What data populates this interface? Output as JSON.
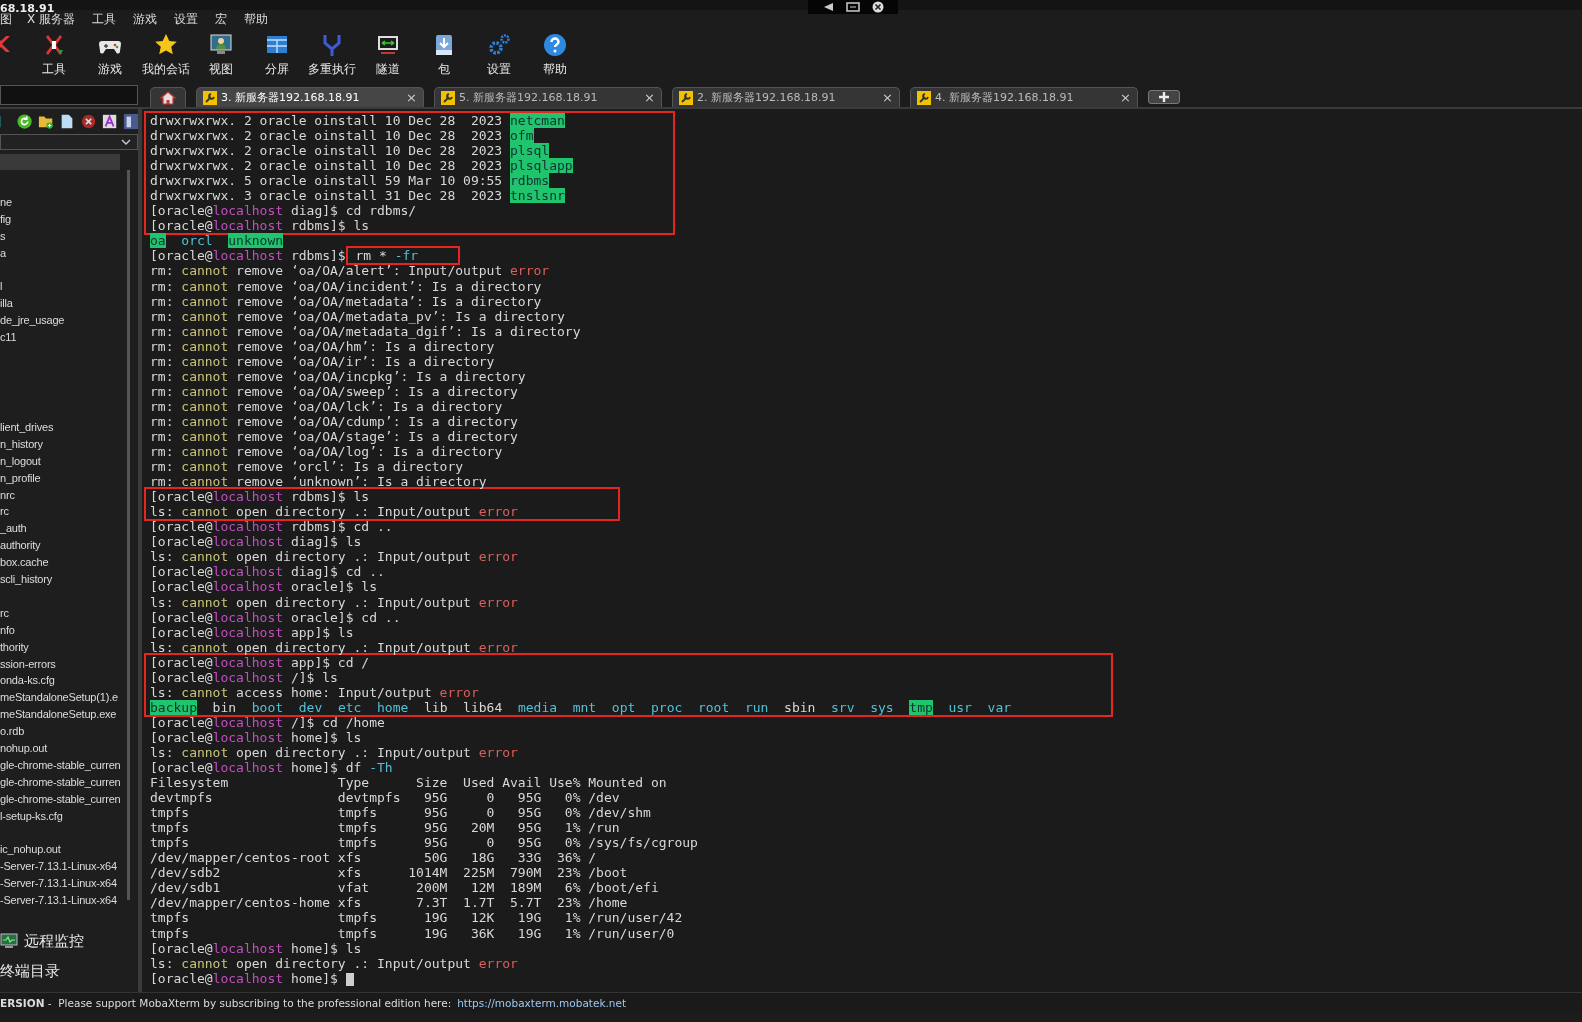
{
  "window": {
    "title": "68.18.91"
  },
  "menu": [
    "图",
    "X 服务器",
    "工具",
    "游戏",
    "设置",
    "宏",
    "帮助"
  ],
  "toolbar": [
    {
      "kind": "server"
    },
    {
      "kind": "tools",
      "label": "工具"
    },
    {
      "kind": "games",
      "label": "游戏"
    },
    {
      "kind": "sessions",
      "label": "我的会话"
    },
    {
      "kind": "view",
      "label": "视图"
    },
    {
      "kind": "split",
      "label": "分屏"
    },
    {
      "kind": "multiexec",
      "label": "多重执行"
    },
    {
      "kind": "tunnel",
      "label": "隧道"
    },
    {
      "kind": "packages",
      "label": "包"
    },
    {
      "kind": "settings",
      "label": "设置"
    },
    {
      "kind": "help",
      "label": "帮助"
    }
  ],
  "tabs": [
    {
      "kind": "home",
      "selected": false
    },
    {
      "kind": "session",
      "label": "3. 新服务器192.168.18.91",
      "close": "×",
      "selected": true
    },
    {
      "kind": "session",
      "label": "5. 新服务器192.168.18.91",
      "close": "×",
      "selected": false
    },
    {
      "kind": "session",
      "label": "2. 新服务器192.168.18.91",
      "close": "×",
      "selected": false
    },
    {
      "kind": "session",
      "label": "4. 新服务器192.168.18.91",
      "close": "×",
      "selected": false
    }
  ],
  "sidebar": {
    "tools": [
      {
        "kind": "terminal"
      },
      {
        "kind": "refresh"
      },
      {
        "kind": "new-folder"
      },
      {
        "kind": "new-file"
      },
      {
        "kind": "delete"
      },
      {
        "kind": "text"
      },
      {
        "kind": "panel"
      }
    ],
    "groups": [
      [
        "ne",
        "fig",
        "s",
        "a"
      ],
      [
        "l",
        "illa",
        "de_jre_usage",
        "c11"
      ],
      [
        "lient_drives",
        "n_history",
        "n_logout",
        "n_profile",
        "nrc",
        "rc",
        "_auth",
        "authority",
        "box.cache",
        "scli_history"
      ],
      [
        "rc",
        "nfo",
        "thority",
        "ssion-errors",
        "onda-ks.cfg",
        "meStandaloneSetup(1).e",
        "meStandaloneSetup.exe",
        "o.rdb",
        "nohup.out",
        "gle-chrome-stable_curren",
        "gle-chrome-stable_curren",
        "gle-chrome-stable_curren",
        "l-setup-ks.cfg"
      ],
      [
        "ic_nohup.out",
        "-Server-7.13.1-Linux-x64",
        "-Server-7.13.1-Linux-x64",
        "-Server-7.13.1-Linux-x64"
      ]
    ],
    "bottom": [
      {
        "kind": "monitor",
        "label": "远程监控"
      },
      {
        "kind": "plain",
        "label": "终端目录"
      }
    ]
  },
  "terminal": {
    "blocks": [
      {
        "boxed": true,
        "lines": [
          {
            "segments": [
              {
                "kind": "text",
                "text": "drwxrwxrwx. 2 oracle oinstall 10 Dec 28  2023 "
              },
              {
                "kind": "dirhl",
                "text": "netcman"
              }
            ]
          },
          {
            "segments": [
              {
                "kind": "text",
                "text": "drwxrwxrwx. 2 oracle oinstall 10 Dec 28  2023 "
              },
              {
                "kind": "dirhl",
                "text": "ofm"
              }
            ]
          },
          {
            "segments": [
              {
                "kind": "text",
                "text": "drwxrwxrwx. 2 oracle oinstall 10 Dec 28  2023 "
              },
              {
                "kind": "dirhl",
                "text": "plsql"
              }
            ]
          },
          {
            "segments": [
              {
                "kind": "text",
                "text": "drwxrwxrwx. 2 oracle oinstall 10 Dec 28  2023 "
              },
              {
                "kind": "dirhl",
                "text": "plsqlapp"
              }
            ]
          },
          {
            "segments": [
              {
                "kind": "text",
                "text": "drwxrwxrwx. 5 oracle oinstall 59 Mar 10 09:55 "
              },
              {
                "kind": "dirhl",
                "text": "rdbms"
              }
            ]
          },
          {
            "segments": [
              {
                "kind": "text",
                "text": "drwxrwxrwx. 3 oracle oinstall 31 Dec 28  2023 "
              },
              {
                "kind": "dirhl",
                "text": "tnslsnr"
              }
            ]
          },
          {
            "segments": [
              {
                "kind": "text",
                "text": "[oracle@"
              },
              {
                "kind": "host",
                "text": "localhost"
              },
              {
                "kind": "text",
                "text": " diag]$ cd rdbms/"
              }
            ]
          },
          {
            "segments": [
              {
                "kind": "text",
                "text": "[oracle@"
              },
              {
                "kind": "host",
                "text": "localhost"
              },
              {
                "kind": "text",
                "text": " rdbms]$ ls"
              }
            ]
          }
        ]
      },
      {
        "boxed": false,
        "lines": [
          {
            "segments": [
              {
                "kind": "dirhl",
                "text": "oa"
              },
              {
                "kind": "dir",
                "text": "  orcl  "
              },
              {
                "kind": "dirhl",
                "text": "unknown"
              }
            ]
          },
          {
            "segments": [
              {
                "kind": "text",
                "text": "[oracle@"
              },
              {
                "kind": "host",
                "text": "localhost"
              },
              {
                "kind": "text",
                "text": " rdbms]$"
              },
              {
                "kind": "group",
                "boxed": true,
                "segments": [
                  {
                    "kind": "text",
                    "text": " rm * "
                  },
                  {
                    "kind": "opt",
                    "text": "-fr"
                  }
                ]
              }
            ]
          },
          {
            "segments": [
              {
                "kind": "text",
                "text": "rm: "
              },
              {
                "kind": "warn",
                "text": "cannot"
              },
              {
                "kind": "text",
                "text": " remove ‘oa/OA/alert’: Input/output "
              },
              {
                "kind": "err",
                "text": "error"
              }
            ]
          },
          {
            "segments": [
              {
                "kind": "text",
                "text": "rm: "
              },
              {
                "kind": "warn",
                "text": "cannot"
              },
              {
                "kind": "text",
                "text": " remove ‘oa/OA/incident’: Is a directory"
              }
            ]
          },
          {
            "segments": [
              {
                "kind": "text",
                "text": "rm: "
              },
              {
                "kind": "warn",
                "text": "cannot"
              },
              {
                "kind": "text",
                "text": " remove ‘oa/OA/metadata’: Is a directory"
              }
            ]
          },
          {
            "segments": [
              {
                "kind": "text",
                "text": "rm: "
              },
              {
                "kind": "warn",
                "text": "cannot"
              },
              {
                "kind": "text",
                "text": " remove ‘oa/OA/metadata_pv’: Is a directory"
              }
            ]
          },
          {
            "segments": [
              {
                "kind": "text",
                "text": "rm: "
              },
              {
                "kind": "warn",
                "text": "cannot"
              },
              {
                "kind": "text",
                "text": " remove ‘oa/OA/metadata_dgif’: Is a directory"
              }
            ]
          },
          {
            "segments": [
              {
                "kind": "text",
                "text": "rm: "
              },
              {
                "kind": "warn",
                "text": "cannot"
              },
              {
                "kind": "text",
                "text": " remove ‘oa/OA/hm’: Is a directory"
              }
            ]
          },
          {
            "segments": [
              {
                "kind": "text",
                "text": "rm: "
              },
              {
                "kind": "warn",
                "text": "cannot"
              },
              {
                "kind": "text",
                "text": " remove ‘oa/OA/ir’: Is a directory"
              }
            ]
          },
          {
            "segments": [
              {
                "kind": "text",
                "text": "rm: "
              },
              {
                "kind": "warn",
                "text": "cannot"
              },
              {
                "kind": "text",
                "text": " remove ‘oa/OA/incpkg’: Is a directory"
              }
            ]
          },
          {
            "segments": [
              {
                "kind": "text",
                "text": "rm: "
              },
              {
                "kind": "warn",
                "text": "cannot"
              },
              {
                "kind": "text",
                "text": " remove ‘oa/OA/sweep’: Is a directory"
              }
            ]
          },
          {
            "segments": [
              {
                "kind": "text",
                "text": "rm: "
              },
              {
                "kind": "warn",
                "text": "cannot"
              },
              {
                "kind": "text",
                "text": " remove ‘oa/OA/lck’: Is a directory"
              }
            ]
          },
          {
            "segments": [
              {
                "kind": "text",
                "text": "rm: "
              },
              {
                "kind": "warn",
                "text": "cannot"
              },
              {
                "kind": "text",
                "text": " remove ‘oa/OA/cdump’: Is a directory"
              }
            ]
          },
          {
            "segments": [
              {
                "kind": "text",
                "text": "rm: "
              },
              {
                "kind": "warn",
                "text": "cannot"
              },
              {
                "kind": "text",
                "text": " remove ‘oa/OA/stage’: Is a directory"
              }
            ]
          },
          {
            "segments": [
              {
                "kind": "text",
                "text": "rm: "
              },
              {
                "kind": "warn",
                "text": "cannot"
              },
              {
                "kind": "text",
                "text": " remove ‘oa/OA/log’: Is a directory"
              }
            ]
          },
          {
            "segments": [
              {
                "kind": "text",
                "text": "rm: "
              },
              {
                "kind": "warn",
                "text": "cannot"
              },
              {
                "kind": "text",
                "text": " remove ‘orcl’: Is a directory"
              }
            ]
          },
          {
            "segments": [
              {
                "kind": "text",
                "text": "rm: "
              },
              {
                "kind": "warn",
                "text": "cannot"
              },
              {
                "kind": "text",
                "text": " remove ‘unknown’: Is a directory"
              }
            ]
          }
        ]
      },
      {
        "boxed": true,
        "lines": [
          {
            "segments": [
              {
                "kind": "text",
                "text": "[oracle@"
              },
              {
                "kind": "host",
                "text": "localhost"
              },
              {
                "kind": "text",
                "text": " rdbms]$ ls"
              }
            ]
          },
          {
            "segments": [
              {
                "kind": "text",
                "text": "ls: "
              },
              {
                "kind": "warn",
                "text": "cannot"
              },
              {
                "kind": "text",
                "text": " open directory .: Input/output "
              },
              {
                "kind": "err",
                "text": "error"
              }
            ]
          }
        ]
      },
      {
        "boxed": false,
        "lines": [
          {
            "segments": [
              {
                "kind": "text",
                "text": "[oracle@"
              },
              {
                "kind": "host",
                "text": "localhost"
              },
              {
                "kind": "text",
                "text": " rdbms]$ cd .."
              }
            ]
          },
          {
            "segments": [
              {
                "kind": "text",
                "text": "[oracle@"
              },
              {
                "kind": "host",
                "text": "localhost"
              },
              {
                "kind": "text",
                "text": " diag]$ ls"
              }
            ]
          },
          {
            "segments": [
              {
                "kind": "text",
                "text": "ls: "
              },
              {
                "kind": "warn",
                "text": "cannot"
              },
              {
                "kind": "text",
                "text": " open directory .: Input/output "
              },
              {
                "kind": "err",
                "text": "error"
              }
            ]
          },
          {
            "segments": [
              {
                "kind": "text",
                "text": "[oracle@"
              },
              {
                "kind": "host",
                "text": "localhost"
              },
              {
                "kind": "text",
                "text": " diag]$ cd .."
              }
            ]
          },
          {
            "segments": [
              {
                "kind": "text",
                "text": "[oracle@"
              },
              {
                "kind": "host",
                "text": "localhost"
              },
              {
                "kind": "text",
                "text": " oracle]$ ls"
              }
            ]
          },
          {
            "segments": [
              {
                "kind": "text",
                "text": "ls: "
              },
              {
                "kind": "warn",
                "text": "cannot"
              },
              {
                "kind": "text",
                "text": " open directory .: Input/output "
              },
              {
                "kind": "err",
                "text": "error"
              }
            ]
          },
          {
            "segments": [
              {
                "kind": "text",
                "text": "[oracle@"
              },
              {
                "kind": "host",
                "text": "localhost"
              },
              {
                "kind": "text",
                "text": " oracle]$ cd .."
              }
            ]
          },
          {
            "segments": [
              {
                "kind": "text",
                "text": "[oracle@"
              },
              {
                "kind": "host",
                "text": "localhost"
              },
              {
                "kind": "text",
                "text": " app]$ ls"
              }
            ]
          },
          {
            "segments": [
              {
                "kind": "text",
                "text": "ls: "
              },
              {
                "kind": "warn",
                "text": "cannot"
              },
              {
                "kind": "text",
                "text": " open directory .: Input/output "
              },
              {
                "kind": "err",
                "text": "error"
              }
            ]
          }
        ]
      },
      {
        "boxed": true,
        "lines": [
          {
            "segments": [
              {
                "kind": "text",
                "text": "[oracle@"
              },
              {
                "kind": "host",
                "text": "localhost"
              },
              {
                "kind": "text",
                "text": " app]$ cd /"
              }
            ]
          },
          {
            "segments": [
              {
                "kind": "text",
                "text": "[oracle@"
              },
              {
                "kind": "host",
                "text": "localhost"
              },
              {
                "kind": "text",
                "text": " /]$ ls"
              }
            ]
          },
          {
            "segments": [
              {
                "kind": "text",
                "text": "ls: "
              },
              {
                "kind": "warn",
                "text": "cannot"
              },
              {
                "kind": "text",
                "text": " access home: Input/output "
              },
              {
                "kind": "err",
                "text": "error"
              }
            ]
          },
          {
            "segments": [
              {
                "kind": "dirhl",
                "text": "backup"
              },
              {
                "kind": "text",
                "text": "  bin  "
              },
              {
                "kind": "dir",
                "text": "boot  "
              },
              {
                "kind": "dir",
                "text": "dev  "
              },
              {
                "kind": "dir",
                "text": "etc  "
              },
              {
                "kind": "dir",
                "text": "home"
              },
              {
                "kind": "text",
                "text": "  lib  lib64  "
              },
              {
                "kind": "dir",
                "text": "media  "
              },
              {
                "kind": "dir",
                "text": "mnt  "
              },
              {
                "kind": "dir",
                "text": "opt  "
              },
              {
                "kind": "dir",
                "text": "proc  "
              },
              {
                "kind": "dir",
                "text": "root  "
              },
              {
                "kind": "dir",
                "text": "run"
              },
              {
                "kind": "text",
                "text": "  sbin  "
              },
              {
                "kind": "dir",
                "text": "srv  "
              },
              {
                "kind": "dir",
                "text": "sys  "
              },
              {
                "kind": "dirhl",
                "text": "tmp"
              },
              {
                "kind": "dir",
                "text": "  usr  "
              },
              {
                "kind": "dir",
                "text": "var"
              }
            ]
          }
        ]
      },
      {
        "boxed": false,
        "lines": [
          {
            "segments": [
              {
                "kind": "text",
                "text": "[oracle@"
              },
              {
                "kind": "host",
                "text": "localhost"
              },
              {
                "kind": "text",
                "text": " /]$ cd /home"
              }
            ]
          },
          {
            "segments": [
              {
                "kind": "text",
                "text": "[oracle@"
              },
              {
                "kind": "host",
                "text": "localhost"
              },
              {
                "kind": "text",
                "text": " home]$ ls"
              }
            ]
          },
          {
            "segments": [
              {
                "kind": "text",
                "text": "ls: "
              },
              {
                "kind": "warn",
                "text": "cannot"
              },
              {
                "kind": "text",
                "text": " open directory .: Input/output "
              },
              {
                "kind": "err",
                "text": "error"
              }
            ]
          },
          {
            "segments": [
              {
                "kind": "text",
                "text": "[oracle@"
              },
              {
                "kind": "host",
                "text": "localhost"
              },
              {
                "kind": "text",
                "text": " home]$ df "
              },
              {
                "kind": "opt",
                "text": "-Th"
              }
            ]
          },
          {
            "segments": [
              {
                "kind": "text",
                "text": "Filesystem              Type      Size  Used Avail Use% Mounted on"
              }
            ]
          },
          {
            "segments": [
              {
                "kind": "text",
                "text": "devtmpfs                devtmpfs   95G     0   95G   0% /dev"
              }
            ]
          },
          {
            "segments": [
              {
                "kind": "text",
                "text": "tmpfs                   tmpfs      95G     0   95G   0% /dev/shm"
              }
            ]
          },
          {
            "segments": [
              {
                "kind": "text",
                "text": "tmpfs                   tmpfs      95G   20M   95G   1% /run"
              }
            ]
          },
          {
            "segments": [
              {
                "kind": "text",
                "text": "tmpfs                   tmpfs      95G     0   95G   0% /sys/fs/cgroup"
              }
            ]
          },
          {
            "segments": [
              {
                "kind": "text",
                "text": "/dev/mapper/centos-root xfs        50G   18G   33G  36% /"
              }
            ]
          },
          {
            "segments": [
              {
                "kind": "text",
                "text": "/dev/sdb2               xfs      1014M  225M  790M  23% /boot"
              }
            ]
          },
          {
            "segments": [
              {
                "kind": "text",
                "text": "/dev/sdb1               vfat      200M   12M  189M   6% /boot/efi"
              }
            ]
          },
          {
            "segments": [
              {
                "kind": "text",
                "text": "/dev/mapper/centos-home xfs       7.3T  1.7T  5.7T  23% /home"
              }
            ]
          },
          {
            "segments": [
              {
                "kind": "text",
                "text": "tmpfs                   tmpfs      19G   12K   19G   1% /run/user/42"
              }
            ]
          },
          {
            "segments": [
              {
                "kind": "text",
                "text": "tmpfs                   tmpfs      19G   36K   19G   1% /run/user/0"
              }
            ]
          },
          {
            "segments": [
              {
                "kind": "text",
                "text": "[oracle@"
              },
              {
                "kind": "host",
                "text": "localhost"
              },
              {
                "kind": "text",
                "text": " home]$ ls"
              }
            ]
          },
          {
            "segments": [
              {
                "kind": "text",
                "text": "ls: "
              },
              {
                "kind": "warn",
                "text": "cannot"
              },
              {
                "kind": "text",
                "text": " open directory .: Input/output "
              },
              {
                "kind": "err",
                "text": "error"
              }
            ]
          },
          {
            "cursor": true,
            "segments": [
              {
                "kind": "text",
                "text": "[oracle@"
              },
              {
                "kind": "host",
                "text": "localhost"
              },
              {
                "kind": "text",
                "text": " home]$ "
              }
            ]
          }
        ]
      }
    ]
  },
  "status_bar": {
    "edition": "ERSION",
    "message": "-  Please support MobaXterm by subscribing to the professional edition here:",
    "link": "https://mobaxterm.mobatek.net"
  }
}
